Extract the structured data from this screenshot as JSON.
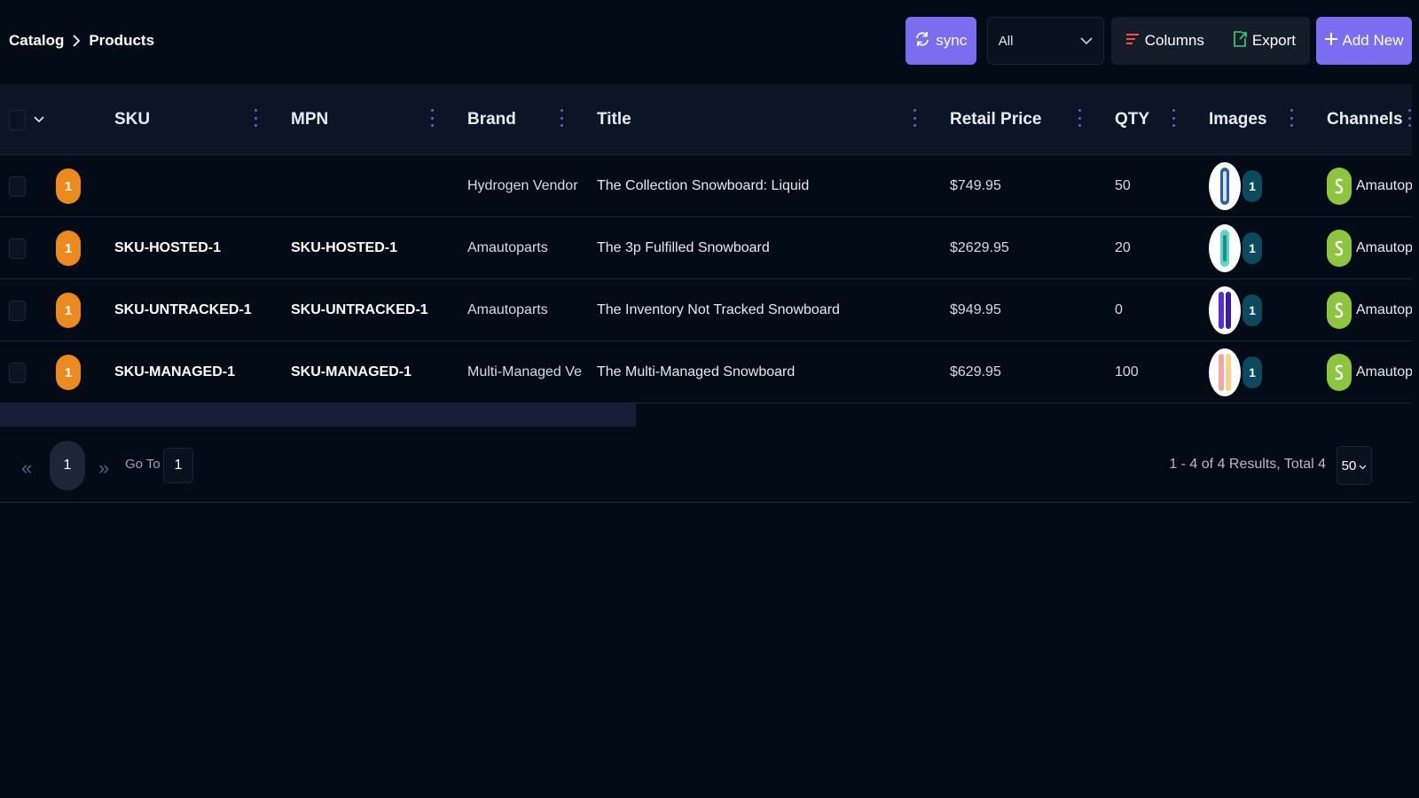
{
  "breadcrumb": {
    "root": "Catalog",
    "current": "Products"
  },
  "toolbar": {
    "sync_label": "sync",
    "filter_value": "All",
    "columns_label": "Columns",
    "export_label": "Export",
    "add_label": "Add New"
  },
  "table": {
    "headers": {
      "sku": "SKU",
      "mpn": "MPN",
      "brand": "Brand",
      "title": "Title",
      "price": "Retail Price",
      "qty": "QTY",
      "images": "Images",
      "channels": "Channels"
    },
    "rows": [
      {
        "badge": "1",
        "sku": "",
        "mpn": "",
        "brand": "Hydrogen Vendor",
        "title": "The Collection Snowboard: Liquid",
        "price": "$749.95",
        "qty": "50",
        "images": "1",
        "channel": "Amautoparts"
      },
      {
        "badge": "1",
        "sku": "SKU-HOSTED-1",
        "mpn": "SKU-HOSTED-1",
        "brand": "Amautoparts",
        "title": "The 3p Fulfilled Snowboard",
        "price": "$2629.95",
        "qty": "20",
        "images": "1",
        "channel": "Amautoparts"
      },
      {
        "badge": "1",
        "sku": "SKU-UNTRACKED-1",
        "mpn": "SKU-UNTRACKED-1",
        "brand": "Amautoparts",
        "title": "The Inventory Not Tracked Snowboard",
        "price": "$949.95",
        "qty": "0",
        "images": "1",
        "channel": "Amautoparts"
      },
      {
        "badge": "1",
        "sku": "SKU-MANAGED-1",
        "mpn": "SKU-MANAGED-1",
        "brand": "Multi-Managed Vend",
        "title": "The Multi-Managed Snowboard",
        "price": "$629.95",
        "qty": "100",
        "images": "1",
        "channel": "Amautoparts"
      }
    ]
  },
  "pagination": {
    "current_page": "1",
    "goto_label": "Go To",
    "goto_value": "1",
    "results": "1 - 4 of 4 Results, Total 4",
    "page_size": "50"
  },
  "colors": {
    "accent": "#7b6cf0",
    "background": "#030b17",
    "badge": "#ec8a1d",
    "shopify": "#8cc63f",
    "image_count": "#0b4a5e"
  },
  "icons": [
    "chevron-right-icon",
    "sync-icon",
    "chevron-down-icon",
    "columns-icon",
    "export-icon",
    "plus-icon",
    "column-menu-icon",
    "shopify-icon",
    "double-chevron-left-icon",
    "double-chevron-right-icon"
  ]
}
